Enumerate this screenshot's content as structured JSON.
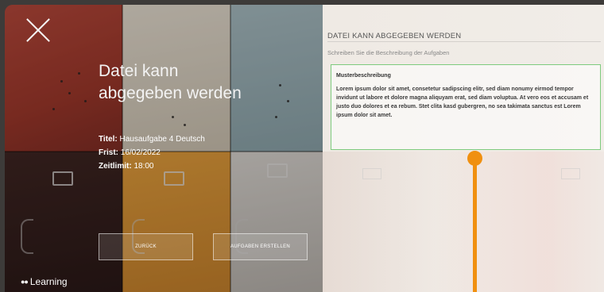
{
  "brand": {
    "dots": "●●",
    "name": "Learning"
  },
  "left": {
    "headline": "Datei kann abgegeben werden",
    "details": [
      {
        "label": "Titel:",
        "value": "Hausaufgabe 4 Deutsch"
      },
      {
        "label": "Frist:",
        "value": "16/02/2022"
      },
      {
        "label": "Zeitlimit:",
        "value": "18:00"
      }
    ],
    "buttons": {
      "back": "ZURÜCK",
      "create": "AUFGABEN ERSTELLEN"
    }
  },
  "right": {
    "title": "DATEI KANN ABGEGEBEN WERDEN",
    "subtitle": "Schreiben Sie die Beschreibung der Aufgaben",
    "description": {
      "heading": "Musterbeschreibung",
      "text": "Lorem ipsum dolor sit amet, consetetur sadipscing elitr, sed diam nonumy eirmod tempor invidunt ut labore et dolore magna aliquyam erat, sed diam voluptua. At vero eos et accusam et justo duo dolores et ea rebum. Stet clita kasd gubergren, no sea takimata sanctus est Lorem ipsum dolor sit amet."
    }
  },
  "colors": {
    "accent": "#f09010",
    "focus_border": "#7ecb7e"
  },
  "icons": {
    "close": "close-icon",
    "resize": "resize-handle"
  }
}
